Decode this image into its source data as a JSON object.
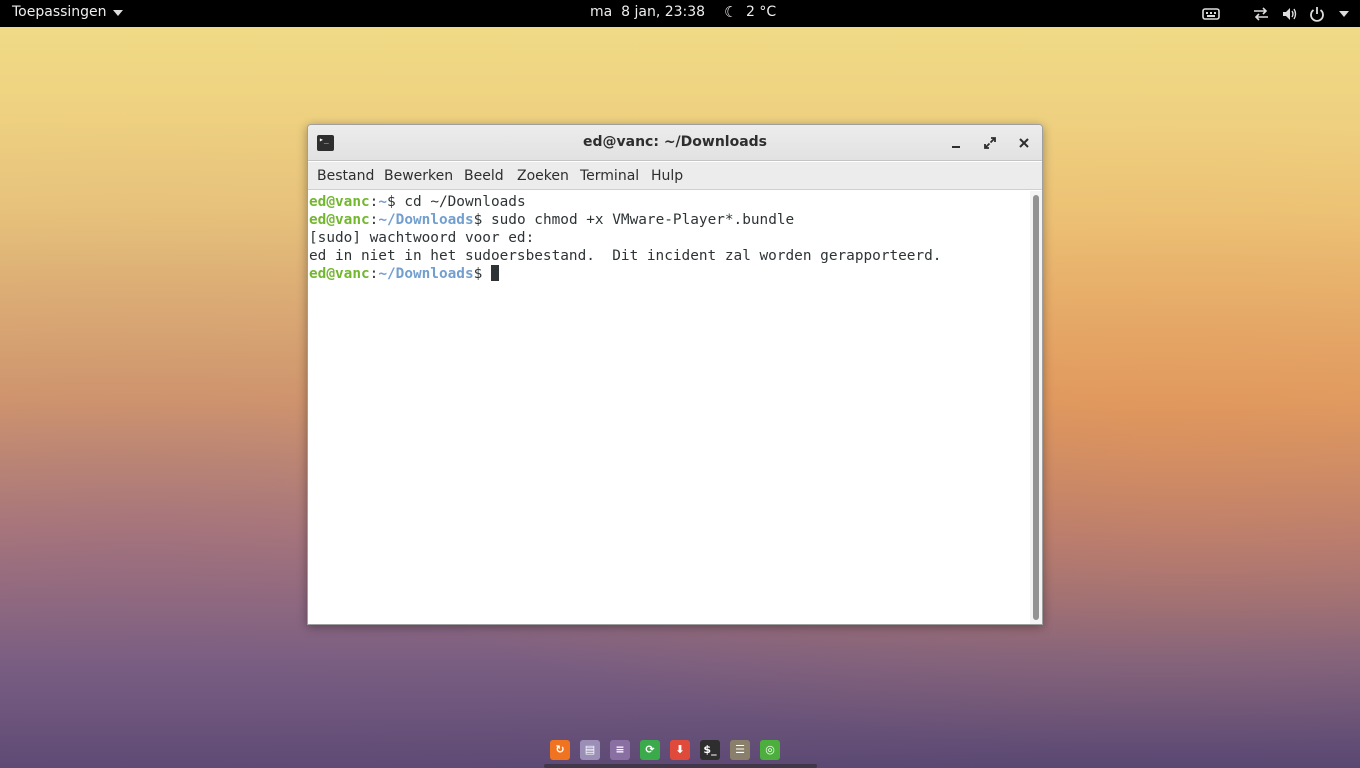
{
  "topbar": {
    "apps_menu_label": "Toepassingen",
    "clock": "ma  8 jan, 23:38",
    "weather_icon": "moon-icon",
    "temperature": "2 °C",
    "tray_icons": [
      "keyboard-icon",
      "network-icon",
      "volume-icon",
      "power-icon",
      "chevron-down-icon"
    ]
  },
  "window": {
    "title": "ed@vanc: ~/Downloads",
    "controls": [
      "minimize-icon",
      "maximize-icon",
      "close-icon"
    ],
    "menu": [
      "Bestand",
      "Bewerken",
      "Beeld",
      "Zoeken",
      "Terminal",
      "Hulp"
    ]
  },
  "terminal": {
    "lines": [
      {
        "user": "ed@vanc",
        "sep": ":",
        "path": "~",
        "rest": "$ cd ~/Downloads"
      },
      {
        "user": "ed@vanc",
        "sep": ":",
        "path": "~/Downloads",
        "rest": "$ sudo chmod +x VMware-Player*.bundle"
      },
      {
        "text": "[sudo] wachtwoord voor ed:"
      },
      {
        "text": "ed in niet in het sudoersbestand.  Dit incident zal worden gerapporteerd."
      },
      {
        "user": "ed@vanc",
        "sep": ":",
        "path": "~/Downloads",
        "rest": "$ "
      }
    ],
    "colors": {
      "user": "#73b72f",
      "path": "#729fcf",
      "text": "#2e3436"
    }
  },
  "dock": {
    "items": [
      {
        "name": "firefox-icon",
        "color": "#f0731f",
        "glyph": "↻"
      },
      {
        "name": "files-icon",
        "color": "#9b8fb8",
        "glyph": "▤"
      },
      {
        "name": "settings-icon",
        "color": "#8a6fa3",
        "glyph": "≡"
      },
      {
        "name": "update-icon",
        "color": "#3aaa4a",
        "glyph": "⟳"
      },
      {
        "name": "download-icon",
        "color": "#e04a3a",
        "glyph": "⬇"
      },
      {
        "name": "terminal-icon",
        "color": "#2e2e2e",
        "glyph": "$_"
      },
      {
        "name": "gimp-icon",
        "color": "#8a7f6a",
        "glyph": "☰"
      },
      {
        "name": "rss-icon",
        "color": "#4cae3c",
        "glyph": "◎"
      }
    ]
  }
}
